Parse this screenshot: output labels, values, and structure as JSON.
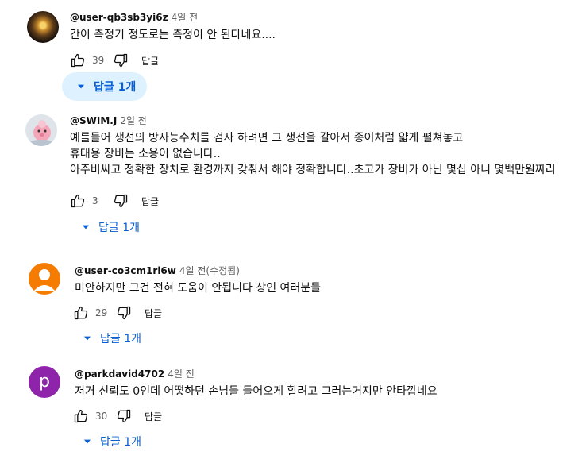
{
  "comments": [
    {
      "author": "@user-qb3sb3yi6z",
      "time": "4일 전",
      "lines": [
        "간이 측정기 정도로는 측정이 안 된다네요...."
      ],
      "likes": "39",
      "reply_label": "답글",
      "replies_label": "답글 1개"
    },
    {
      "author": "@SWIM.J",
      "time": "2일 전",
      "lines": [
        "예를들어 생선의 방사능수치를 검사 하려면 그 생선을 갈아서 종이처럼 얇게 펼쳐놓고",
        "휴대용 장비는 소용이 없습니다..",
        "아주비싸고 정확한 장치로 환경까지 갖춰서 해야 정확합니다..초고가 장비가 아닌 몇십 아니 몇백만원짜리"
      ],
      "likes": "3",
      "reply_label": "답글",
      "replies_label": "답글 1개"
    },
    {
      "author": "@user-co3cm1ri6w",
      "time": "4일 전(수정됨)",
      "lines": [
        "미안하지만 그건 전혀 도움이 안됩니다 상인 여러분들"
      ],
      "likes": "29",
      "reply_label": "답글",
      "replies_label": "답글 1개"
    },
    {
      "author": "@parkdavid4702",
      "time": "4일 전",
      "avatar_letter": "p",
      "lines": [
        "저거 신뢰도 0인데 어떻하던 손님들 들어오게 할려고 그러는거지만 안타깝네요"
      ],
      "likes": "30",
      "reply_label": "답글",
      "replies_label": "답글 1개"
    }
  ],
  "colors": {
    "link_blue": "#065fd4",
    "active_bg": "#def1ff",
    "secondary_text": "#606060"
  }
}
